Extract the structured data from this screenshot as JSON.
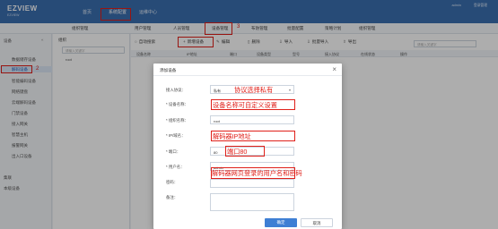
{
  "app": {
    "logo": "EZVIEW",
    "logo_sub": "EZVIEW"
  },
  "top_nav": [
    "首页",
    "系统配置",
    "运维中心"
  ],
  "top_user": {
    "name": "admin",
    "action": "登录管理"
  },
  "sub_nav": [
    "组织管理",
    "用户管理",
    "人员管理",
    "设备管理",
    "布防管理",
    "批量配置",
    "策略计划",
    "组织管理"
  ],
  "sidebar": {
    "header": "设备",
    "toggle": "«",
    "items": [
      "数据储存设备",
      "解码设备",
      "智能编码设备",
      "网络键盘",
      "云端解码设备",
      "门禁设备",
      "接入网关",
      "智慧主机",
      "报警网关",
      "出入口设备",
      "集联",
      "本级设备"
    ]
  },
  "tree_panel": {
    "title": "组织",
    "search_placeholder": "请输入关键字",
    "root": "root"
  },
  "toolbar": {
    "buttons": [
      "自动搜索",
      "新增设备",
      "编辑",
      "删除",
      "导入",
      "批量导入",
      "导出"
    ],
    "search_placeholder": "请输入关键字"
  },
  "table_headers": [
    "设备名称",
    "IP地址",
    "端口",
    "设备类型",
    "型号",
    "接入协议",
    "在线状态",
    "操作"
  ],
  "modal": {
    "title": "添加设备",
    "fields": [
      {
        "label": "接入协议：",
        "value": "私有",
        "annotation": "协议选择私有"
      },
      {
        "label": "* 设备名称：",
        "value": "",
        "annotation": "设备名称可自定义设置"
      },
      {
        "label": "* 组织名称：",
        "value": "root",
        "annotation": ""
      },
      {
        "label": "* IP/域名：",
        "value": "",
        "annotation": "解码器IP地址"
      },
      {
        "label": "* 端口：",
        "value": "80",
        "annotation": "端口80"
      },
      {
        "label": "* 用户名：",
        "value": "admin",
        "annotation": "解码器网页登录的用户名和密码"
      },
      {
        "label": "密码：",
        "value": "",
        "annotation": ""
      },
      {
        "label": "备注：",
        "value": "",
        "annotation": ""
      }
    ],
    "ok_label": "确定",
    "cancel_label": "取消"
  },
  "annotation_numbers": [
    "1",
    "2",
    "3"
  ],
  "colors": {
    "topbar": "#3a6fb0",
    "annotation": "#e0201a",
    "primary": "#3e7fd4"
  }
}
